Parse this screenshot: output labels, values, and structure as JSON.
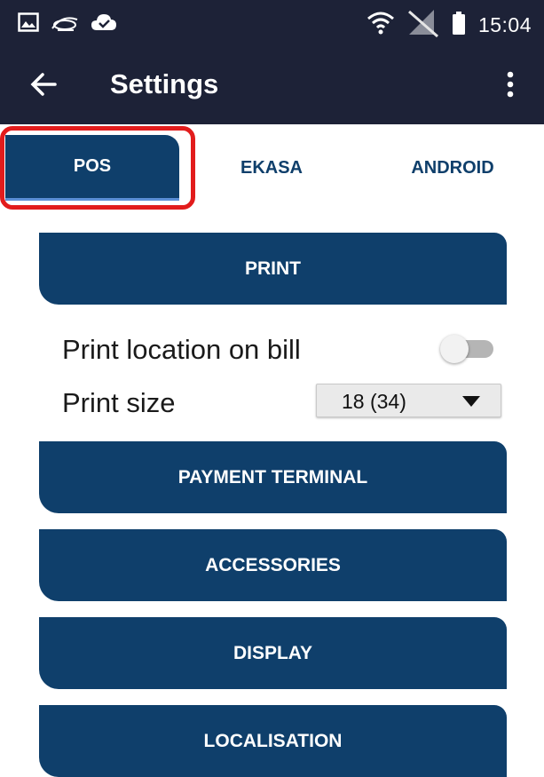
{
  "status_bar": {
    "time": "15:04",
    "icons": [
      "image-icon",
      "satellite-icon",
      "cloud-check-icon",
      "wifi-icon",
      "signal-off-icon",
      "battery-icon"
    ]
  },
  "app_bar": {
    "title": "Settings",
    "back_icon": "arrow-left-icon",
    "menu_icon": "more-vert-icon"
  },
  "tabs": [
    {
      "label": "POS",
      "selected": true
    },
    {
      "label": "EKASA",
      "selected": false
    },
    {
      "label": "ANDROID",
      "selected": false
    }
  ],
  "sections": {
    "print": "PRINT",
    "payment_terminal": "PAYMENT TERMINAL",
    "accessories": "ACCESSORIES",
    "display": "DISPLAY",
    "localisation": "LOCALISATION"
  },
  "print_settings": {
    "location_label": "Print location on bill",
    "location_enabled": false,
    "size_label": "Print size",
    "size_value": "18 (34)"
  },
  "colors": {
    "status_bar_bg": "#1d2237",
    "primary": "#0f3f6b",
    "highlight": "#e21c1c"
  }
}
